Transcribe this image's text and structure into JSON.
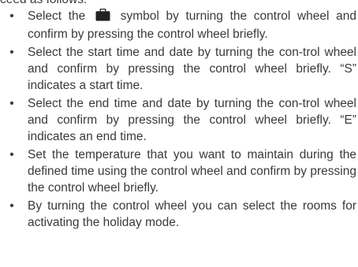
{
  "top_fragment": "ceed as follows:",
  "bullet_char": "•",
  "items": [
    {
      "before_icon": "Select the",
      "icon": "suitcase-icon",
      "after_icon": "symbol by turning the control wheel and confirm by pressing the control wheel briefly."
    },
    {
      "text": "Select the start time and date by turning the con-trol wheel and confirm by pressing the control wheel briefly. “S” indicates a start time."
    },
    {
      "text": "Select the end time and date by turning the con-trol wheel and confirm by pressing the control wheel briefly. “E” indicates an end time."
    },
    {
      "text": "Set the temperature that you want to maintain during the defined time using the control wheel and confirm by pressing the control wheel briefly."
    },
    {
      "text": "By turning the control wheel you can select the rooms for activating the holiday mode."
    }
  ]
}
